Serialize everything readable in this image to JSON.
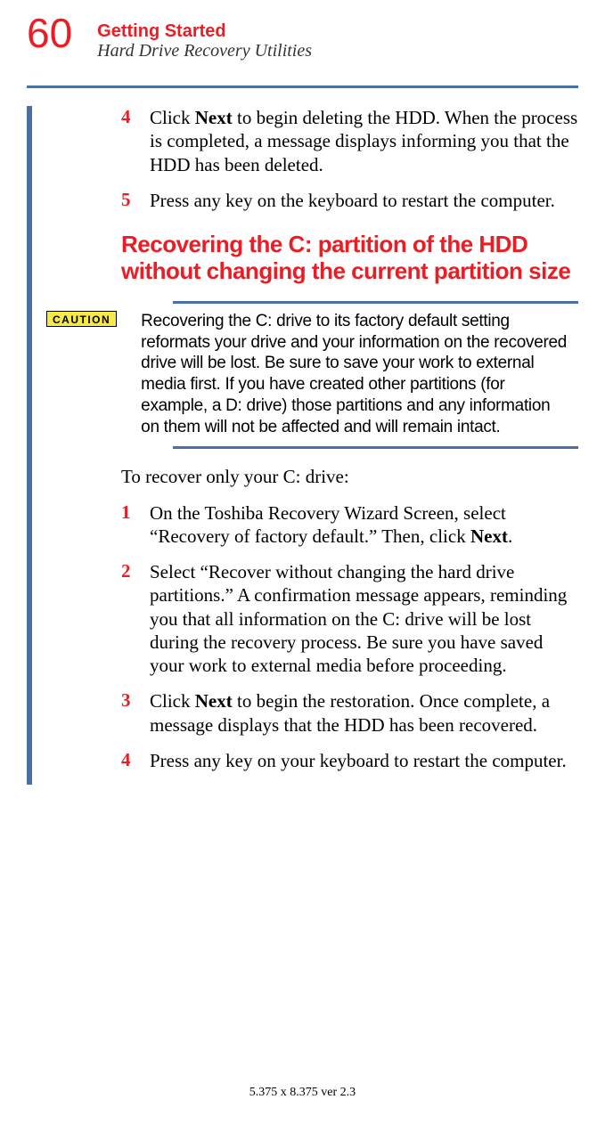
{
  "header": {
    "page_number": "60",
    "title": "Getting Started",
    "subtitle": "Hard Drive Recovery Utilities"
  },
  "initial_steps": [
    {
      "num": "4",
      "pre": "Click ",
      "bold1": "Next",
      "post": " to begin deleting the HDD. When the process is completed, a message displays informing you that the HDD has been deleted."
    },
    {
      "num": "5",
      "pre": "Press any key on the keyboard to restart the computer.",
      "bold1": "",
      "post": ""
    }
  ],
  "section_heading": "Recovering the C: partition of the HDD without changing the current partition size",
  "caution": {
    "label": "CAUTION",
    "text": "Recovering the C: drive to its factory default setting reformats your drive and your information on the recovered drive will be lost. Be sure to save your work to external media first. If you have created other partitions (for example, a D: drive) those partitions and any information on them will not be affected and will remain intact."
  },
  "intro": "To recover only your C: drive:",
  "steps": [
    {
      "num": "1",
      "pre": "On the Toshiba Recovery Wizard Screen, select “Recovery of factory default.” Then, click ",
      "bold1": "Next",
      "post": "."
    },
    {
      "num": "2",
      "pre": "Select “Recover without changing the hard drive partitions.” A confirmation message appears, reminding you that all information on the C: drive will be lost during the recovery process. Be sure you have saved your work to external media before proceeding.",
      "bold1": "",
      "post": ""
    },
    {
      "num": "3",
      "pre": "Click ",
      "bold1": "Next",
      "post": " to begin the restoration. Once complete, a message displays that the HDD has been recovered."
    },
    {
      "num": "4",
      "pre": "Press any key on your keyboard to restart the computer.",
      "bold1": "",
      "post": ""
    }
  ],
  "footer": "5.375 x 8.375 ver 2.3"
}
